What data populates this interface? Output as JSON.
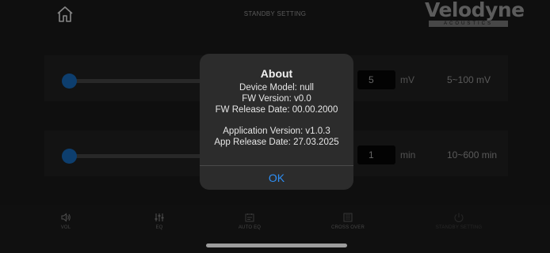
{
  "header": {
    "title": "STANDBY SETTING",
    "home_icon": "home-icon",
    "logo": {
      "word": "Velodyne",
      "sub": "ACOUSTICS"
    }
  },
  "settings": [
    {
      "value": "5",
      "unit": "mV",
      "range": "5~100 mV"
    },
    {
      "value": "1",
      "unit": "min",
      "range": "10~600 min"
    }
  ],
  "dialog": {
    "title": "About",
    "lines": [
      "Device Model: null",
      "FW Version: v0.0",
      "FW Release Date: 00.00.2000",
      "Application Version: v1.0.3",
      "App Release Date: 27.03.2025"
    ],
    "ok_label": "OK",
    "ok_color": "#2e8ff5"
  },
  "nav": [
    {
      "label": "VOL",
      "icon": "speaker-icon"
    },
    {
      "label": "EQ",
      "icon": "equalizer-icon"
    },
    {
      "label": "AUTO EQ",
      "icon": "auto-eq-icon"
    },
    {
      "label": "CROSS OVER",
      "icon": "crossover-icon"
    },
    {
      "label": "STANDBY SETTING",
      "icon": "standby-icon"
    }
  ],
  "colors": {
    "accent": "#1460aa",
    "background": "#181818"
  }
}
